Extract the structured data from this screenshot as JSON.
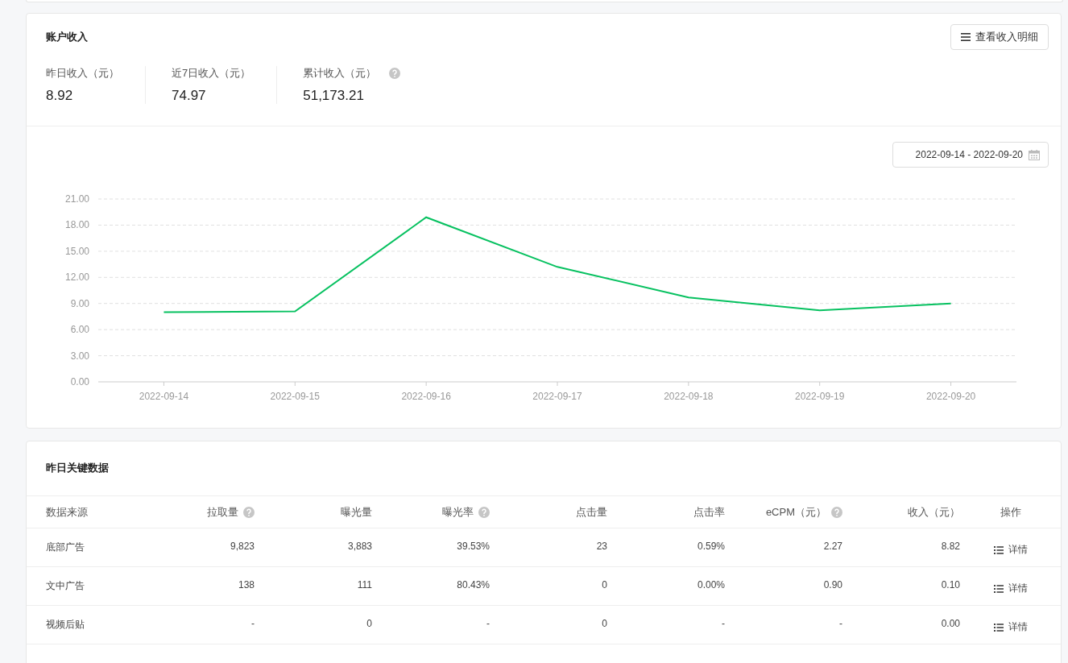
{
  "income_card": {
    "title": "账户收入",
    "detail_button": "查看收入明细",
    "stats": [
      {
        "label": "昨日收入（元）",
        "value": "8.92",
        "help": false
      },
      {
        "label": "近7日收入（元）",
        "value": "74.97",
        "help": false
      },
      {
        "label": "累计收入（元）",
        "value": "51,173.21",
        "help": true
      }
    ],
    "date_range": "2022-09-14 - 2022-09-20",
    "chart_data": {
      "type": "line",
      "categories": [
        "2022-09-14",
        "2022-09-15",
        "2022-09-16",
        "2022-09-17",
        "2022-09-18",
        "2022-09-19",
        "2022-09-20"
      ],
      "series": [
        {
          "color": "#07c160",
          "values": [
            8.0,
            8.1,
            18.9,
            13.2,
            9.7,
            8.2,
            9.0
          ]
        }
      ],
      "ylim": [
        0,
        21
      ],
      "grid": true,
      "yticks": [
        {
          "value": 0,
          "label": "0.00"
        },
        {
          "value": 3,
          "label": "3.00"
        },
        {
          "value": 6,
          "label": "6.00"
        },
        {
          "value": 9,
          "label": "9.00"
        },
        {
          "value": 12,
          "label": "12.00"
        },
        {
          "value": 15,
          "label": "15.00"
        },
        {
          "value": 18,
          "label": "18.00"
        },
        {
          "value": 21,
          "label": "21.00"
        }
      ]
    }
  },
  "key_data": {
    "title": "昨日关键数据",
    "columns": [
      {
        "label": "数据来源",
        "help": false
      },
      {
        "label": "拉取量",
        "help": true
      },
      {
        "label": "曝光量",
        "help": false
      },
      {
        "label": "曝光率",
        "help": true
      },
      {
        "label": "点击量",
        "help": false
      },
      {
        "label": "点击率",
        "help": false
      },
      {
        "label": "eCPM（元）",
        "help": true
      },
      {
        "label": "收入（元）",
        "help": false
      },
      {
        "label": "操作",
        "help": false
      }
    ],
    "rows": [
      {
        "cells": [
          "底部广告",
          "9,823",
          "3,883",
          "39.53%",
          "23",
          "0.59%",
          "2.27",
          "8.82"
        ],
        "action": "详情"
      },
      {
        "cells": [
          "文中广告",
          "138",
          "111",
          "80.43%",
          "0",
          "0.00%",
          "0.90",
          "0.10"
        ],
        "action": "详情"
      },
      {
        "cells": [
          "视频后贴",
          "-",
          "0",
          "-",
          "0",
          "-",
          "-",
          "0.00"
        ],
        "action": "详情"
      }
    ]
  }
}
